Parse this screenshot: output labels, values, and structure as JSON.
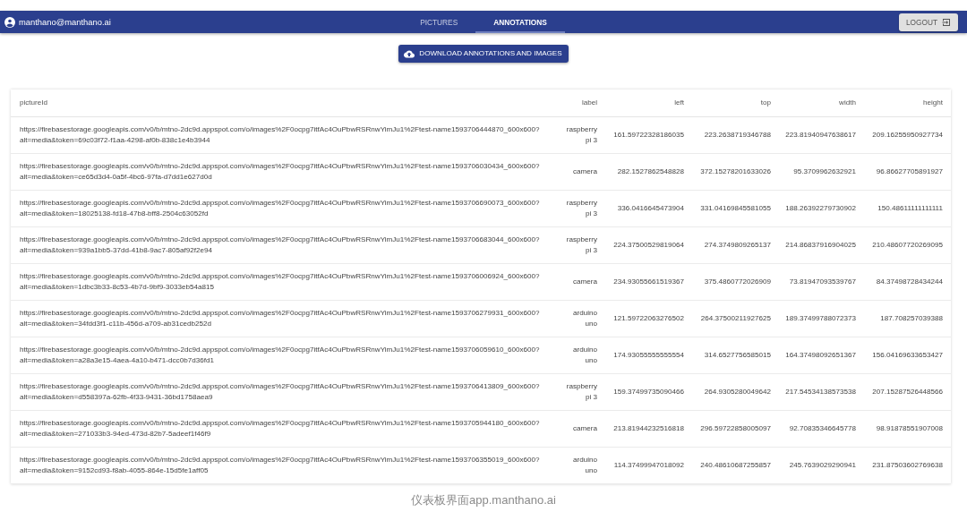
{
  "user": {
    "email": "manthano@manthano.ai"
  },
  "tabs": [
    {
      "label": "PICTURES",
      "selected": false
    },
    {
      "label": "ANNOTATIONS",
      "selected": true
    }
  ],
  "logout_button": {
    "label": "LOGOUT"
  },
  "download_button": {
    "label": "DOWNLOAD ANNOTATIONS AND IMAGES"
  },
  "table": {
    "columns": [
      "pictureId",
      "label",
      "left",
      "top",
      "width",
      "height"
    ],
    "rows": [
      [
        "https://firebasestorage.googleapis.com/v0/b/mtno-2dc9d.appspot.com/o/images%2F0ocpg7itfAc4OuPbwRSRnwYimJu1%2Ftest-name1593706444870_600x600?\nalt=media&token=69c03f72-f1aa-4298-af0b-838c1e4b3944",
        "raspberry pi 3",
        "161.59722328186035",
        "223.2638719346788",
        "223.81940947638617",
        "209.16255950927734"
      ],
      [
        "https://firebasestorage.googleapis.com/v0/b/mtno-2dc9d.appspot.com/o/images%2F0ocpg7itfAc4OuPbwRSRnwYimJu1%2Ftest-name1593706030434_600x600?\nalt=media&token=ce65d3d4-0a5f-4bc6-97fa-d7dd1e627d0d",
        "camera",
        "282.1527862548828",
        "372.15278201633026",
        "95.3709962632921",
        "96.86627705891927"
      ],
      [
        "https://firebasestorage.googleapis.com/v0/b/mtno-2dc9d.appspot.com/o/images%2F0ocpg7itfAc4OuPbwRSRnwYimJu1%2Ftest-name1593706690073_600x600?\nalt=media&token=18025138-fd18-47b8-bff8-2504c63052fd",
        "raspberry pi 3",
        "336.0416645473904",
        "331.04169845581055",
        "188.26392279730902",
        "150.48611111111111"
      ],
      [
        "https://firebasestorage.googleapis.com/v0/b/mtno-2dc9d.appspot.com/o/images%2F0ocpg7itfAc4OuPbwRSRnwYimJu1%2Ftest-name1593706683044_600x600?\nalt=media&token=939a1bb5-37dd-41b8-9ac7-805af92f2e94",
        "raspberry pi 3",
        "224.37500529819064",
        "274.3749809265137",
        "214.86837916904025",
        "210.48607720269095"
      ],
      [
        "https://firebasestorage.googleapis.com/v0/b/mtno-2dc9d.appspot.com/o/images%2F0ocpg7itfAc4OuPbwRSRnwYimJu1%2Ftest-name1593706006924_600x600?\nalt=media&token=1dbc3b33-8c53-4b7d-9bf9-3033eb54a815",
        "camera",
        "234.93055661519367",
        "375.4860772026909",
        "73.81947093539767",
        "84.37498728434244"
      ],
      [
        "https://firebasestorage.googleapis.com/v0/b/mtno-2dc9d.appspot.com/o/images%2F0ocpg7itfAc4OuPbwRSRnwYimJu1%2Ftest-name1593706279931_600x600?\nalt=media&token=34fdd3f1-c11b-456d-a709-ab31cedb252d",
        "arduino uno",
        "121.59722063276502",
        "264.37500211927625",
        "189.37499788072373",
        "187.708257039388"
      ],
      [
        "https://firebasestorage.googleapis.com/v0/b/mtno-2dc9d.appspot.com/o/images%2F0ocpg7itfAc4OuPbwRSRnwYimJu1%2Ftest-name1593706059610_600x600?\nalt=media&token=a28a3e15-4aea-4a10-b471-dcc0b7d36fd1",
        "arduino uno",
        "174.93055555555554",
        "314.6527756585015",
        "164.37498092651367",
        "156.04169633653427"
      ],
      [
        "https://firebasestorage.googleapis.com/v0/b/mtno-2dc9d.appspot.com/o/images%2F0ocpg7itfAc4OuPbwRSRnwYimJu1%2Ftest-name1593706413809_600x600?\nalt=media&token=d558397a-62fb-4f33-9431-36bd1758aea9",
        "raspberry pi 3",
        "159.37499735090466",
        "264.9305280049642",
        "217.54534138573538",
        "207.15287526448566"
      ],
      [
        "https://firebasestorage.googleapis.com/v0/b/mtno-2dc9d.appspot.com/o/images%2F0ocpg7itfAc4OuPbwRSRnwYimJu1%2Ftest-name1593705944180_600x600?\nalt=media&token=271033b3-94ed-473d-82b7-5adeef1f46f9",
        "camera",
        "213.81944232516818",
        "296.59722858005097",
        "92.70835346645778",
        "98.91878551907008"
      ],
      [
        "https://firebasestorage.googleapis.com/v0/b/mtno-2dc9d.appspot.com/o/images%2F0ocpg7itfAc4OuPbwRSRnwYimJu1%2Ftest-name1593706355019_600x600?\nalt=media&token=9152cd93-f8ab-4055-864e-15d5fe1aff05",
        "arduino uno",
        "114.37499947018092",
        "240.48610687255857",
        "245.7639029290941",
        "231.87503602769638"
      ]
    ]
  },
  "caption": "仪表板界面app.manthano.ai"
}
